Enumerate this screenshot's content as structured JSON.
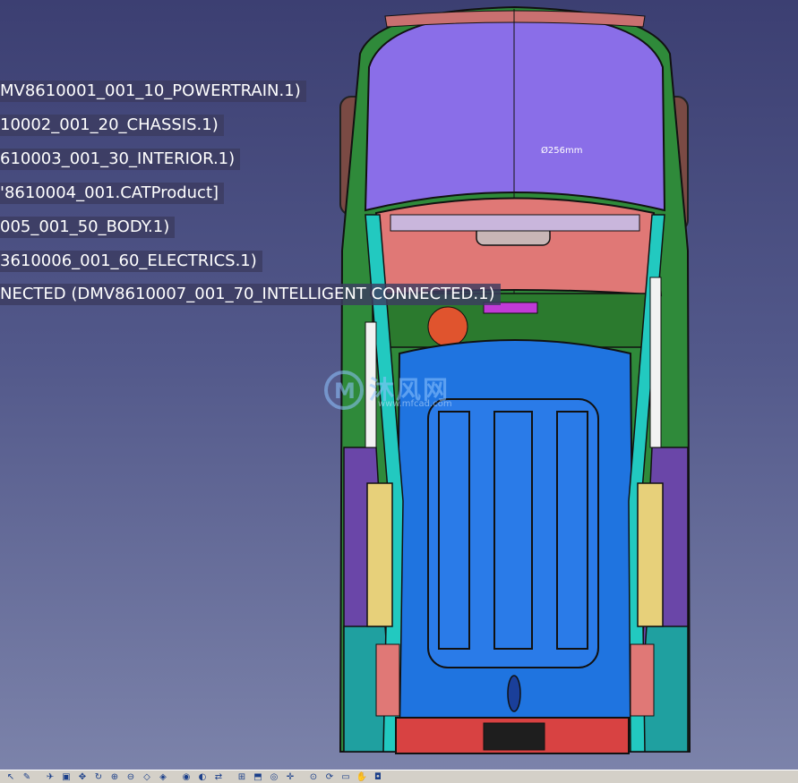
{
  "tree_labels": [
    "MV8610001_001_10_POWERTRAIN.1)",
    "10002_001_20_CHASSIS.1)",
    "610003_001_30_INTERIOR.1)",
    "'8610004_001.CATProduct]",
    "005_001_50_BODY.1)",
    "3610006_001_60_ELECTRICS.1)",
    "NECTED (DMV8610007_001_70_INTELLIGENT CONNECTED.1)"
  ],
  "dimension_label": "Ø256mm",
  "watermark": {
    "main": "沐风网",
    "sub": "www.mfcad.com"
  },
  "toolbar_icons": [
    "select-icon",
    "sketch-icon",
    "fly-mode-icon",
    "fit-all-icon",
    "pan-icon",
    "rotate-icon",
    "zoom-in-icon",
    "zoom-out-icon",
    "normal-view-icon",
    "iso-view-icon",
    "shading-icon",
    "hide-show-icon",
    "swap-visible-icon",
    "measure-icon",
    "section-icon",
    "analysis-icon",
    "compass-icon",
    "snap-icon",
    "update-icon",
    "car-icon",
    "manipulate-icon",
    "camera-icon"
  ]
}
